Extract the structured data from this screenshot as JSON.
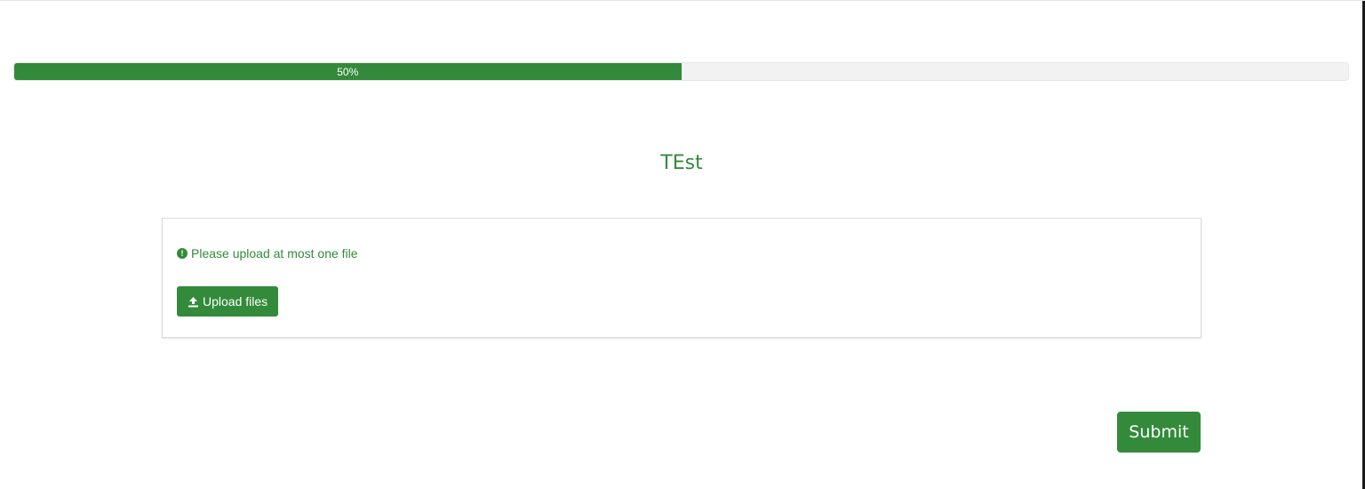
{
  "progress": {
    "value_percent": 50,
    "label": "50%"
  },
  "page": {
    "title": "TEst"
  },
  "upload": {
    "warning_text": "Please upload at most one file",
    "warning_icon": "exclamation-circle-icon",
    "button_label": "Upload files",
    "button_icon": "upload-icon"
  },
  "actions": {
    "submit_label": "Submit"
  },
  "colors": {
    "accent": "#338a3a",
    "track": "#f2f2f2"
  }
}
